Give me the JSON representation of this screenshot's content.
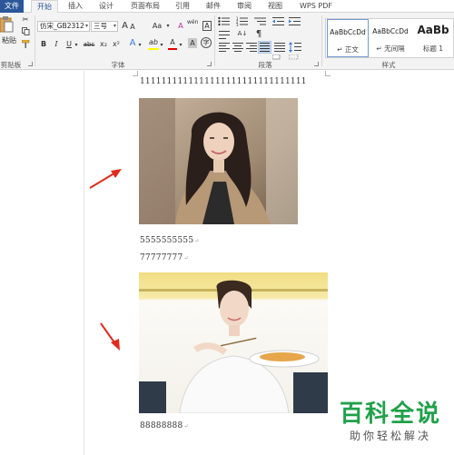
{
  "tabs": [
    {
      "label": "文件"
    },
    {
      "label": "开始"
    },
    {
      "label": "插入"
    },
    {
      "label": "设计"
    },
    {
      "label": "页面布局"
    },
    {
      "label": "引用"
    },
    {
      "label": "邮件"
    },
    {
      "label": "审阅"
    },
    {
      "label": "视图"
    },
    {
      "label": "WPS PDF"
    }
  ],
  "ribbon": {
    "clipboard": {
      "paste_label": "粘贴",
      "group_label": "剪贴板"
    },
    "font": {
      "font_name": "仿宋_GB2312",
      "font_size": "三号",
      "grow_label": "A",
      "shrink_label": "A",
      "case_label": "Aa",
      "clear_label": "A",
      "wen_label": "wén",
      "char_border_label": "A",
      "bold": "B",
      "italic": "I",
      "underline": "U",
      "strike": "abc",
      "subscript": "x₂",
      "superscript": "x²",
      "effect_label": "A",
      "highlight_label": "ab",
      "font_color_label": "A",
      "char_shade_label": "A",
      "enclose_label": "字",
      "group_label": "字体"
    },
    "paragraph": {
      "group_label": "段落",
      "sort_label": "A↓",
      "showmarks_label": "¶"
    },
    "styles": {
      "items": [
        {
          "sample": "AaBbCcDd",
          "name": "↵ 正文"
        },
        {
          "sample": "AaBbCcDd",
          "name": "↵ 无间隔"
        },
        {
          "sample": "AaBb",
          "name": "标题 1"
        }
      ],
      "group_label": "样式"
    }
  },
  "document": {
    "lines": [
      {
        "text": "1111111111111111111111111111111"
      },
      {
        "text": "5555555555"
      },
      {
        "text": "77777777"
      },
      {
        "text": "88888888"
      }
    ],
    "para_mark": "↵"
  },
  "watermark": {
    "title": "百科全说",
    "subtitle": "助你轻松解决"
  },
  "colors": {
    "file_tab": "#2b579a",
    "arrow": "#e02a1e",
    "highlight": "#ffff00",
    "font_color": "#e00000",
    "watermark": "#20a14a"
  }
}
